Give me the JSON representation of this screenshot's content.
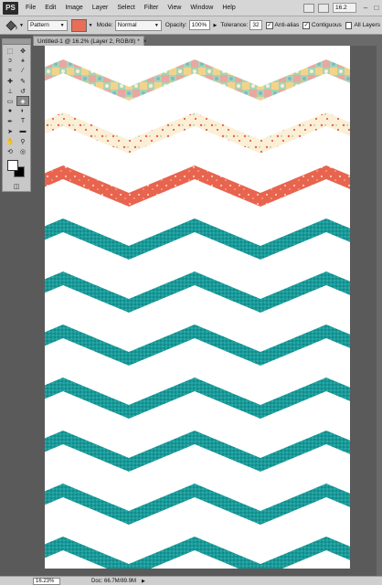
{
  "menubar": {
    "logo": "PS",
    "items": [
      "File",
      "Edit",
      "Image",
      "Layer",
      "Select",
      "Filter",
      "View",
      "Window",
      "Help"
    ],
    "zoom_value": "16.2"
  },
  "options": {
    "fill_source": "Pattern",
    "mode_label": "Mode:",
    "mode_value": "Normal",
    "opacity_label": "Opacity:",
    "opacity_value": "100%",
    "tolerance_label": "Tolerance:",
    "tolerance_value": "32",
    "antialias_label": "Anti-alias",
    "contiguous_label": "Contiguous",
    "all_layers_label": "All Layers",
    "pattern_color": "#e86e59"
  },
  "document": {
    "tab_title": "Untitled-1 @ 16.2% (Layer 2, RGB/8) *",
    "close": "×"
  },
  "status": {
    "zoom": "16.23%",
    "doc_size": "Doc: 66.7M/89.9M",
    "arrow": "▶"
  },
  "colors": {
    "teal": "#1b9a98",
    "coral": "#e8644f",
    "cream": "#fbefd6",
    "mint": "#a8d4b4",
    "pink": "#e9a7a0"
  }
}
